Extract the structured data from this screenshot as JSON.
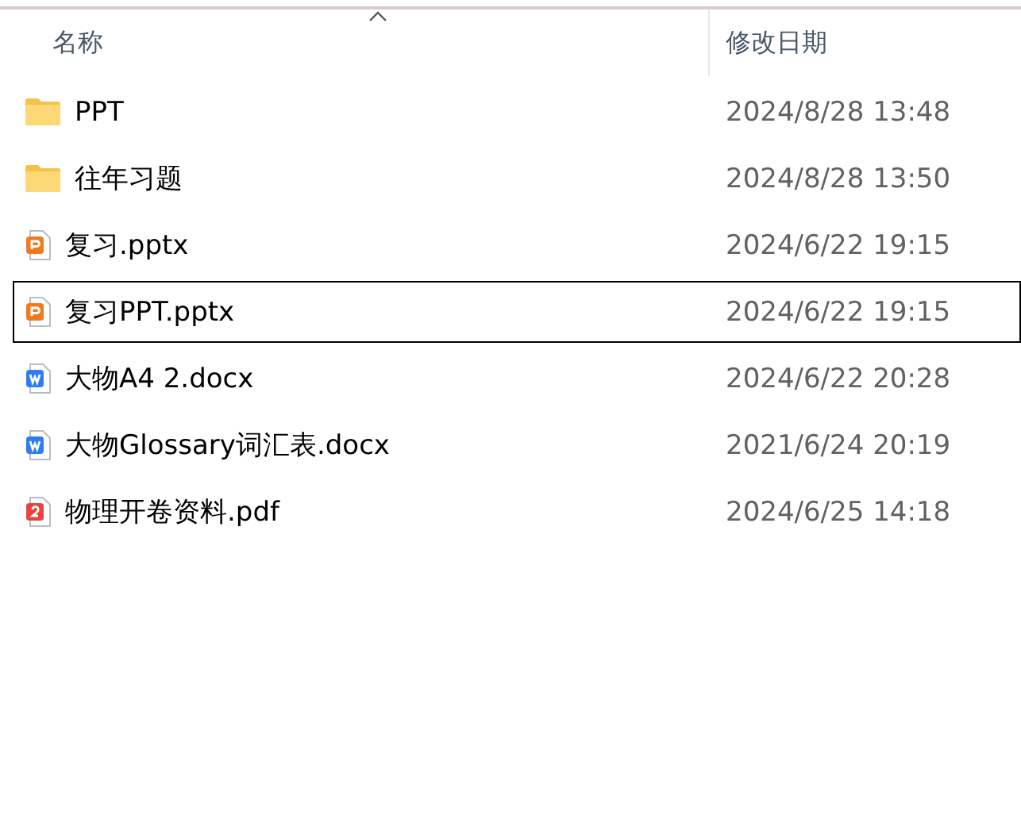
{
  "columns": [
    {
      "label": "名称",
      "sorted": true
    },
    {
      "label": "修改日期",
      "sorted": false
    }
  ],
  "files": [
    {
      "kind": "folder",
      "name": "PPT",
      "modified": "2024/8/28 13:48",
      "selected": false
    },
    {
      "kind": "folder",
      "name": "往年习题",
      "modified": "2024/8/28 13:50",
      "selected": false
    },
    {
      "kind": "ppt",
      "name": "复习.pptx",
      "modified": "2024/6/22 19:15",
      "selected": false
    },
    {
      "kind": "ppt",
      "name": "复习PPT.pptx",
      "modified": "2024/6/22 19:15",
      "selected": true
    },
    {
      "kind": "doc",
      "name": "大物A4 2.docx",
      "modified": "2024/6/22 20:28",
      "selected": false
    },
    {
      "kind": "doc",
      "name": "大物Glossary词汇表.docx",
      "modified": "2021/6/24 20:19",
      "selected": false
    },
    {
      "kind": "pdf",
      "name": "物理开卷资料.pdf",
      "modified": "2024/6/25 14:18",
      "selected": false
    }
  ]
}
